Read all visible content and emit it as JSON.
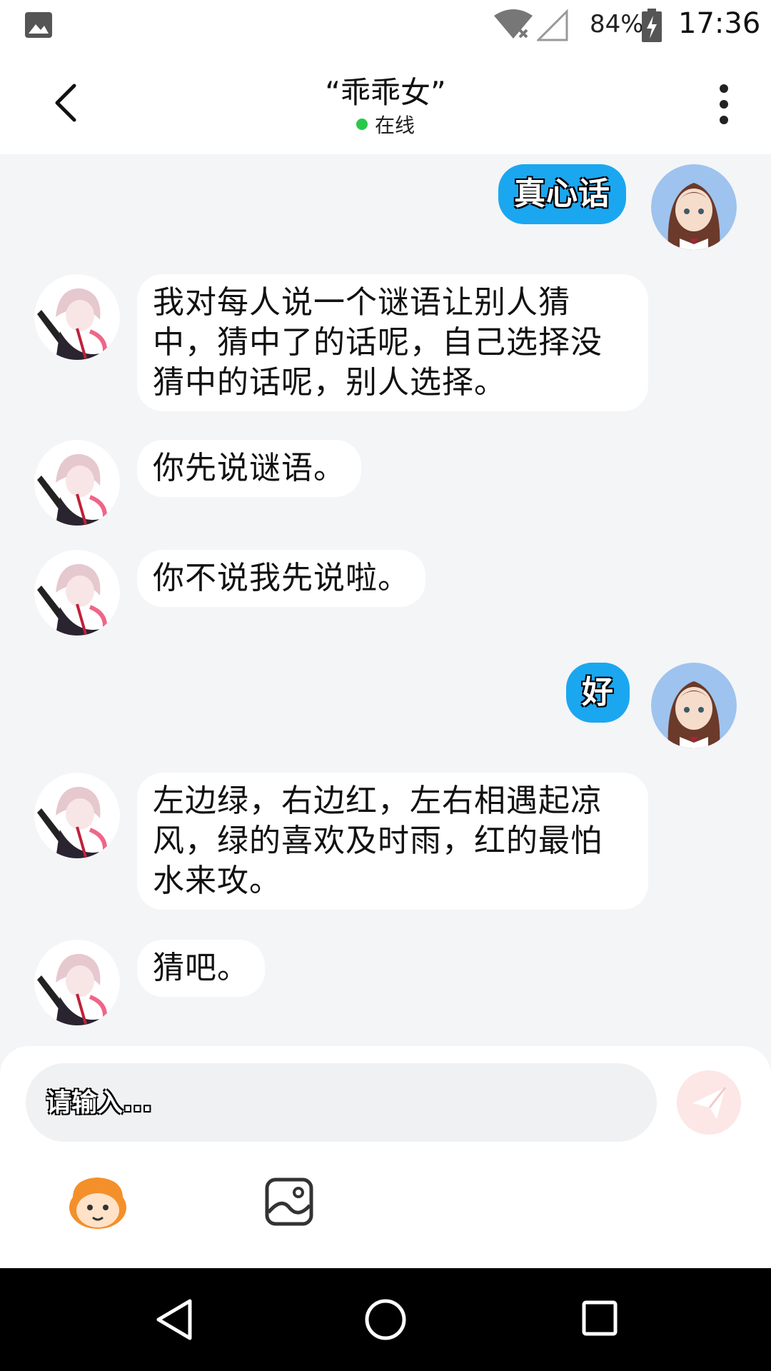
{
  "status_bar": {
    "battery_percent": "84%",
    "time": "17:36"
  },
  "header": {
    "title": "“乖乖女”",
    "status": "在线"
  },
  "messages": [
    {
      "side": "right",
      "text": "真心话"
    },
    {
      "side": "left",
      "text": "我对每人说一个谜语让别人猜中，猜中了的话呢，自己选择没猜中的话呢，别人选择。"
    },
    {
      "side": "left",
      "text": "你先说谜语。"
    },
    {
      "side": "left",
      "text": "你不说我先说啦。"
    },
    {
      "side": "right",
      "text": "好"
    },
    {
      "side": "left",
      "text": "左边绿，右边红，左右相遇起凉风，绿的喜欢及时雨，红的最怕水来攻。"
    },
    {
      "side": "left",
      "text": "猜吧。"
    }
  ],
  "composer": {
    "placeholder": "请输入..."
  },
  "colors": {
    "out_bubble": "#1aa7f0",
    "in_bubble": "#ffffff",
    "online": "#2ac84a",
    "send_button": "#fde6e6"
  }
}
